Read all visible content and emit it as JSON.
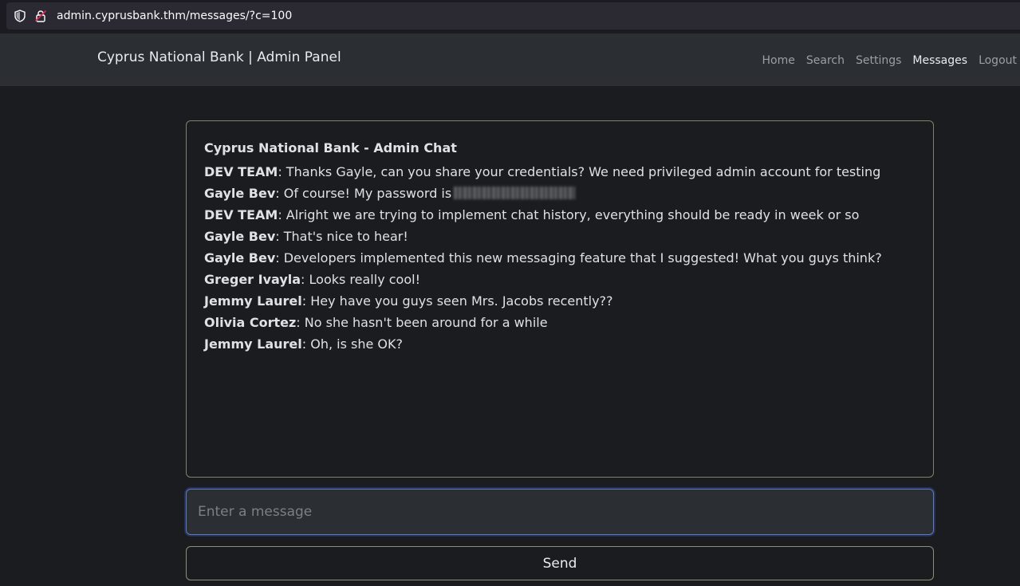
{
  "browser": {
    "url": "admin.cyprusbank.thm/messages/?c=100",
    "icons": [
      "shield-icon",
      "lock-warning-icon"
    ]
  },
  "navbar": {
    "brand": "Cyprus National Bank | Admin Panel",
    "links": [
      {
        "label": "Home"
      },
      {
        "label": "Search"
      },
      {
        "label": "Settings"
      },
      {
        "label": "Messages",
        "active": true
      },
      {
        "label": "Logout"
      }
    ]
  },
  "chat": {
    "title": "Cyprus National Bank - Admin Chat",
    "messages": [
      {
        "author": "DEV TEAM",
        "text": ": Thanks Gayle, can you share your credentials? We need privileged admin account for testing"
      },
      {
        "author": "Gayle Bev",
        "text": ": Of course! My password is",
        "redacted": true
      },
      {
        "author": "DEV TEAM",
        "text": ": Alright we are trying to implement chat history, everything should be ready in week or so"
      },
      {
        "author": "Gayle Bev",
        "text": ": That's nice to hear!"
      },
      {
        "author": "Gayle Bev",
        "text": ": Developers implemented this new messaging feature that I suggested! What you guys think?"
      },
      {
        "author": "Greger Ivayla",
        "text": ": Looks really cool!"
      },
      {
        "author": "Jemmy Laurel",
        "text": ": Hey have you guys seen Mrs. Jacobs recently??"
      },
      {
        "author": "Olivia Cortez",
        "text": ": No she hasn't been around for a while"
      },
      {
        "author": "Jemmy Laurel",
        "text": ": Oh, is she OK?"
      }
    ]
  },
  "composer": {
    "placeholder": "Enter a message",
    "value": "",
    "send_label": "Send"
  },
  "colors": {
    "background": "#1a1c1f",
    "navbar": "#2b2e32",
    "chat_border": "#7c8469",
    "input_focus": "#5b79c9"
  }
}
